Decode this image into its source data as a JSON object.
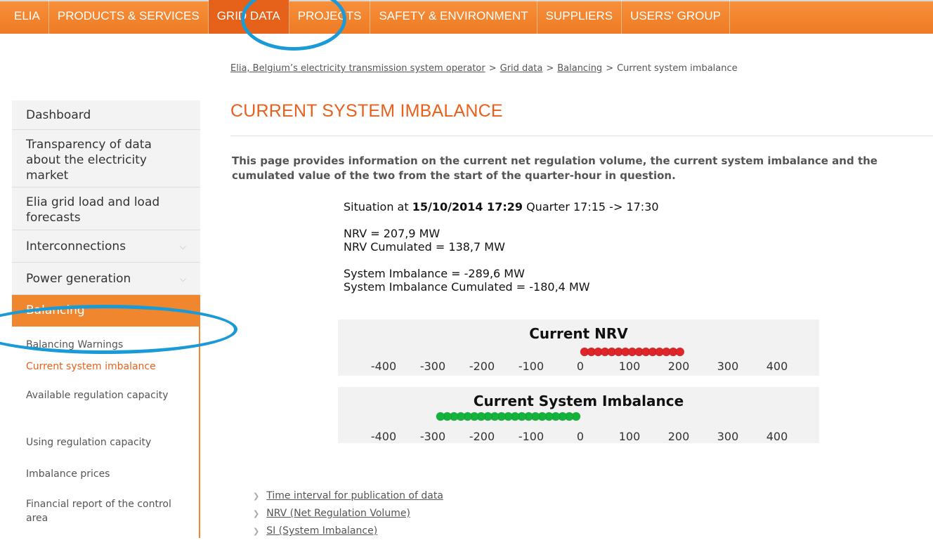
{
  "nav": {
    "items": [
      "ELIA",
      "PRODUCTS & SERVICES",
      "GRID DATA",
      "PROJECTS",
      "SAFETY & ENVIRONMENT",
      "SUPPLIERS",
      "USERS' GROUP"
    ],
    "active": "GRID DATA",
    "accent": "#f0862d",
    "highlight_color": "#1a9bd8"
  },
  "breadcrumb": {
    "items": [
      "Elia, Belgium’s electricity transmission system operator",
      "Grid data",
      "Balancing",
      "Current system imbalance"
    ],
    "separator": ">"
  },
  "sidebar": {
    "items": [
      {
        "label": "Dashboard"
      },
      {
        "label": "Transparency of data about the electricity market"
      },
      {
        "label": "Elia grid load and load forecasts"
      },
      {
        "label": "Interconnections",
        "icon": "chevron-down-icon"
      },
      {
        "label": "Power generation",
        "icon": "chevron-down-icon"
      },
      {
        "label": "Balancing",
        "active": true
      }
    ],
    "subitems": [
      {
        "label": "Balancing Warnings"
      },
      {
        "label": "Current system imbalance",
        "active": true
      },
      {
        "label": "Available regulation capacity"
      },
      {
        "label": "Using regulation capacity"
      },
      {
        "label": "Imbalance prices"
      },
      {
        "label": "Financial report of the control area"
      }
    ]
  },
  "main": {
    "title": "CURRENT SYSTEM IMBALANCE",
    "intro": "This page provides information on the current net regulation volume, the current system imbalance and the cumulated value of the two from the start of the quarter-hour in question.",
    "status": {
      "situation_prefix": "Situation at",
      "timestamp": "15/10/2014 17:29",
      "quarter": "Quarter 17:15 -> 17:30",
      "nrv": "NRV = 207,9 MW",
      "nrv_cumulated": "NRV Cumulated = 138,7 MW",
      "si": "System Imbalance = -289,6 MW",
      "si_cumulated": "System Imbalance Cumulated = -180,4 MW"
    },
    "links": [
      "Time interval for publication of data",
      "NRV (Net Regulation Volume)",
      "SI (System Imbalance)"
    ]
  },
  "chart_data": [
    {
      "type": "bar",
      "title": "Current NRV",
      "ticks": [
        -400,
        -300,
        -200,
        -100,
        0,
        100,
        200,
        300,
        400
      ],
      "value": 207.9,
      "color": "#e0252a"
    },
    {
      "type": "bar",
      "title": "Current System Imbalance",
      "ticks": [
        -400,
        -300,
        -200,
        -100,
        0,
        100,
        200,
        300,
        400
      ],
      "value": -289.6,
      "color": "#14b43c"
    }
  ]
}
